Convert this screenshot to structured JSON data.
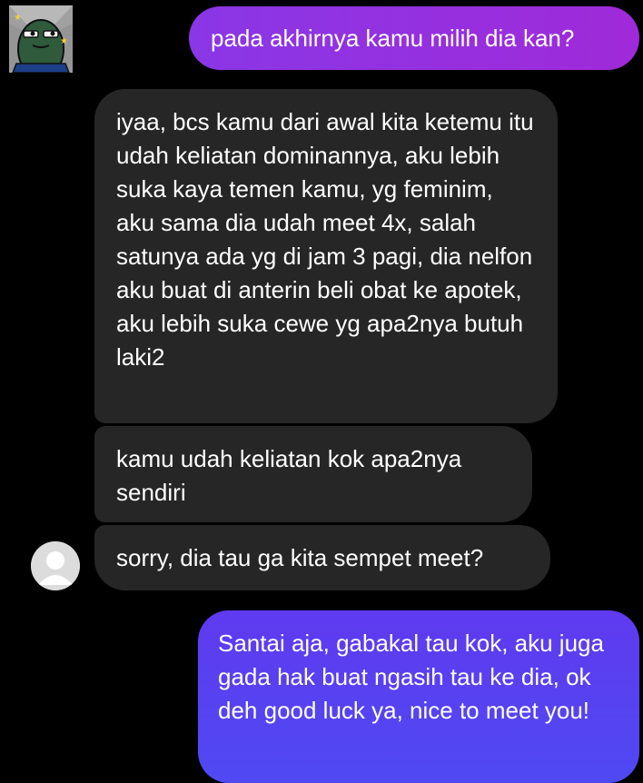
{
  "conversation": {
    "messages": [
      {
        "sender": "me",
        "text": "pada akhirnya kamu milih dia kan?"
      },
      {
        "sender": "them",
        "text": "iyaa, bcs kamu dari awal kita ketemu itu udah keliatan dominannya, aku lebih suka kaya temen kamu, yg feminim, aku sama dia udah meet 4x, salah satunya ada yg di jam 3 pagi, dia nelfon aku buat di anterin beli obat ke apotek, aku lebih suka cewe yg apa2nya butuh laki2"
      },
      {
        "sender": "them",
        "text": "kamu udah keliatan kok apa2nya sendiri"
      },
      {
        "sender": "them",
        "text": "sorry, dia tau ga kita sempet meet?"
      },
      {
        "sender": "me",
        "text": "Santai aja, gabakal tau kok, aku juga gada hak buat ngasih tau ke dia, ok deh good luck ya, nice to meet you!"
      }
    ]
  },
  "colors": {
    "background": "#000000",
    "incoming_bubble": "#262626",
    "outgoing_bubble_top": "#9431e0",
    "outgoing_bubble_bottom": "#5640f0",
    "text": "#ffffff"
  },
  "icons": {
    "sender_avatar": "cartoon-avatar-icon",
    "contact_avatar": "default-user-avatar-icon"
  }
}
